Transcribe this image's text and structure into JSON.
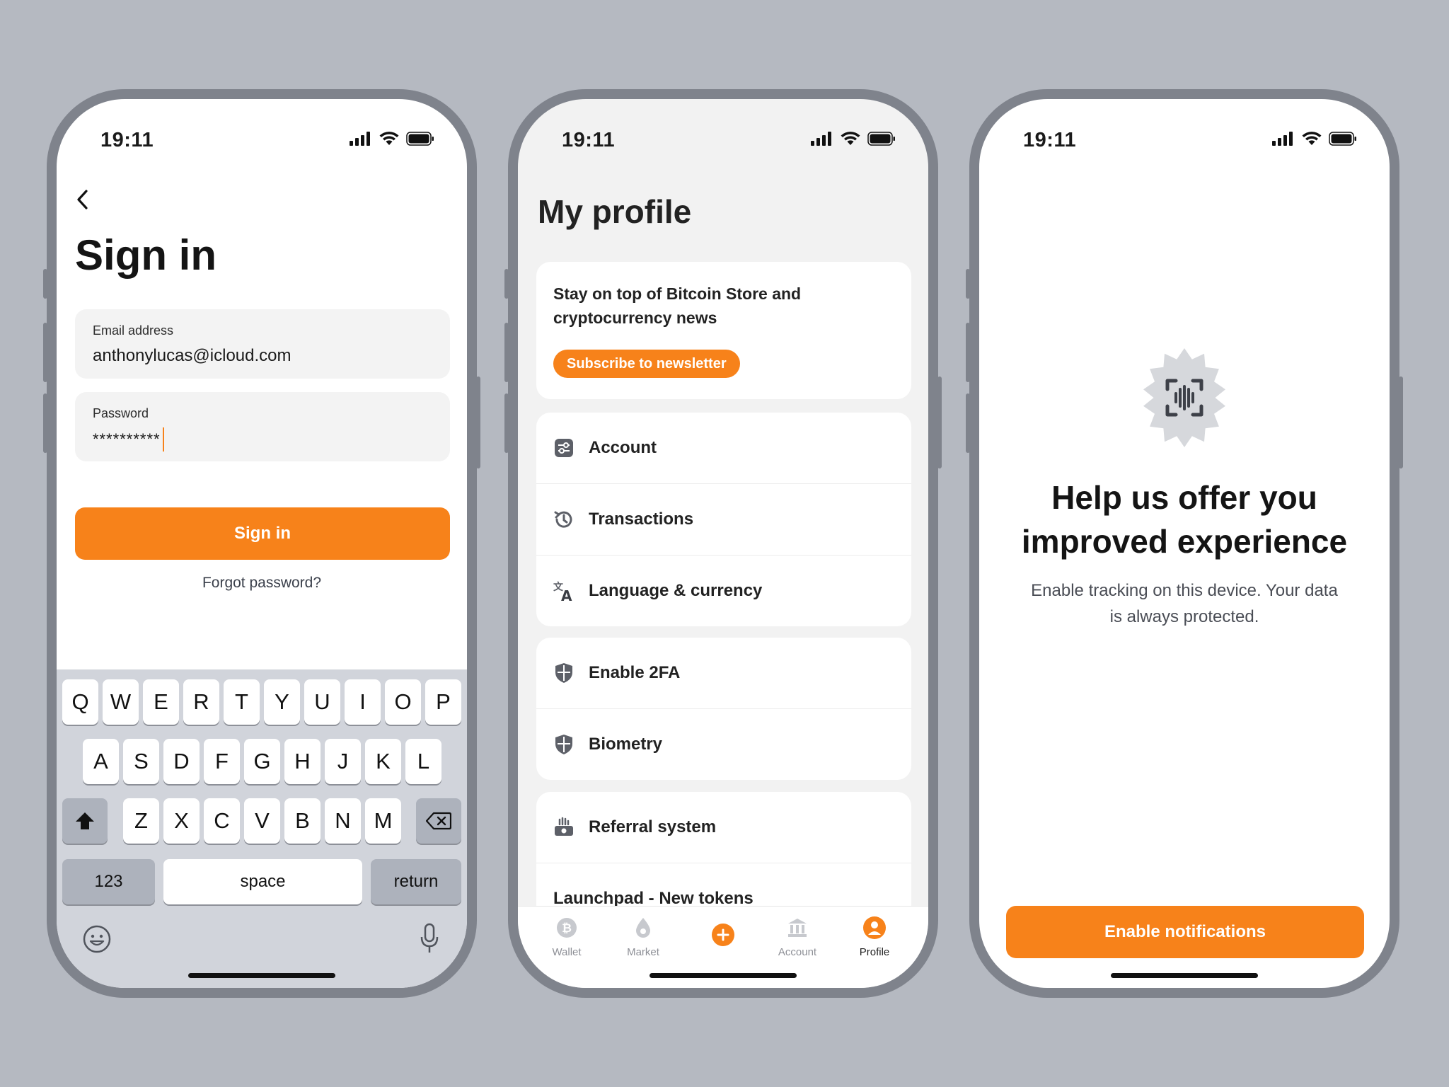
{
  "colors": {
    "accent": "#f7821a",
    "background": "#b5b9c1",
    "frame": "#7f838c",
    "screen_gray": "#f2f2f2"
  },
  "status_time": "19:11",
  "signin": {
    "title": "Sign in",
    "email_label": "Email address",
    "email_value": "anthonylucas@icloud.com",
    "password_label": "Password",
    "password_value": "**********",
    "button_label": "Sign in",
    "forgot_label": "Forgot password?",
    "keyboard": {
      "row1": [
        "Q",
        "W",
        "E",
        "R",
        "T",
        "Y",
        "U",
        "I",
        "O",
        "P"
      ],
      "row2": [
        "A",
        "S",
        "D",
        "F",
        "G",
        "H",
        "J",
        "K",
        "L"
      ],
      "row3": [
        "Z",
        "X",
        "C",
        "V",
        "B",
        "N",
        "M"
      ],
      "numbers_label": "123",
      "space_label": "space",
      "return_label": "return"
    }
  },
  "profile": {
    "title": "My profile",
    "newsletter_text": "Stay on top of Bitcoin Store and cryptocurrency news",
    "newsletter_button": "Subscribe to newsletter",
    "menu": {
      "account": "Account",
      "transactions": "Transactions",
      "language": "Language & currency",
      "enable_2fa": "Enable 2FA",
      "biometry": "Biometry",
      "referral": "Referral system",
      "launchpad": "Launchpad - New tokens"
    },
    "tabs": {
      "wallet": "Wallet",
      "market": "Market",
      "account": "Account",
      "profile": "Profile"
    }
  },
  "tracking": {
    "title": "Help us offer you improved experience",
    "subtitle": "Enable tracking on this device. Your data is always protected.",
    "button_label": "Enable notifications"
  }
}
